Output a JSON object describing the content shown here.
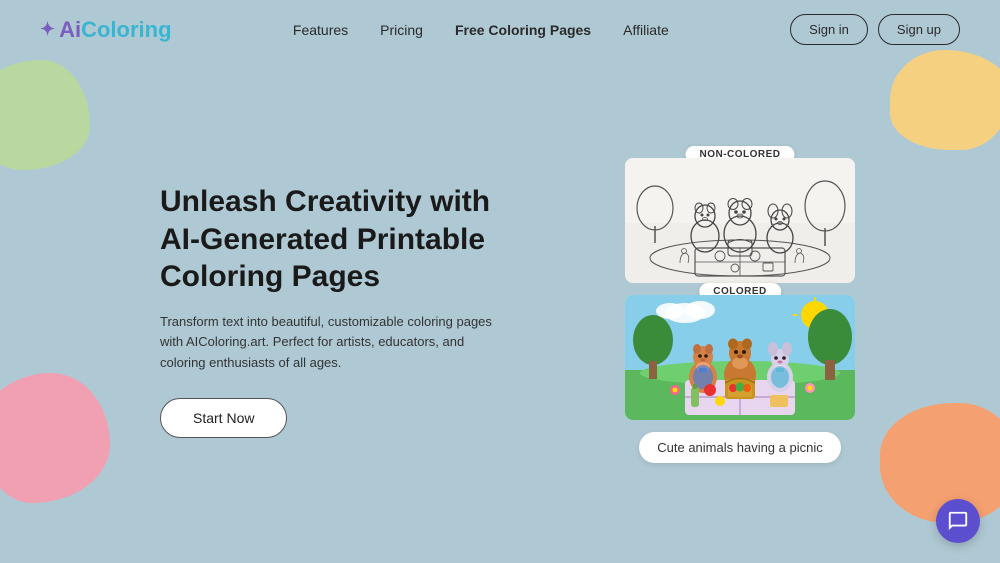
{
  "brand": {
    "sparkle": "✦",
    "name_part1": "Ai",
    "name_part2": "Coloring"
  },
  "nav": {
    "items": [
      {
        "label": "Features",
        "href": "#"
      },
      {
        "label": "Pricing",
        "href": "#"
      },
      {
        "label": "Free Coloring Pages",
        "href": "#",
        "active": true
      },
      {
        "label": "Affiliate",
        "href": "#"
      }
    ]
  },
  "auth": {
    "signin_label": "Sign in",
    "signup_label": "Sign up"
  },
  "hero": {
    "title": "Unleash Creativity with AI-Generated Printable Coloring Pages",
    "description": "Transform text into beautiful, customizable coloring pages with AIColoring.art. Perfect for artists, educators, and coloring enthusiasts of all ages.",
    "cta_label": "Start Now"
  },
  "images": {
    "badge_noncolored": "NON-COLORED",
    "badge_colored": "COLORED",
    "caption": "Cute animals having a picnic"
  },
  "chat": {
    "aria_label": "Support chat"
  }
}
